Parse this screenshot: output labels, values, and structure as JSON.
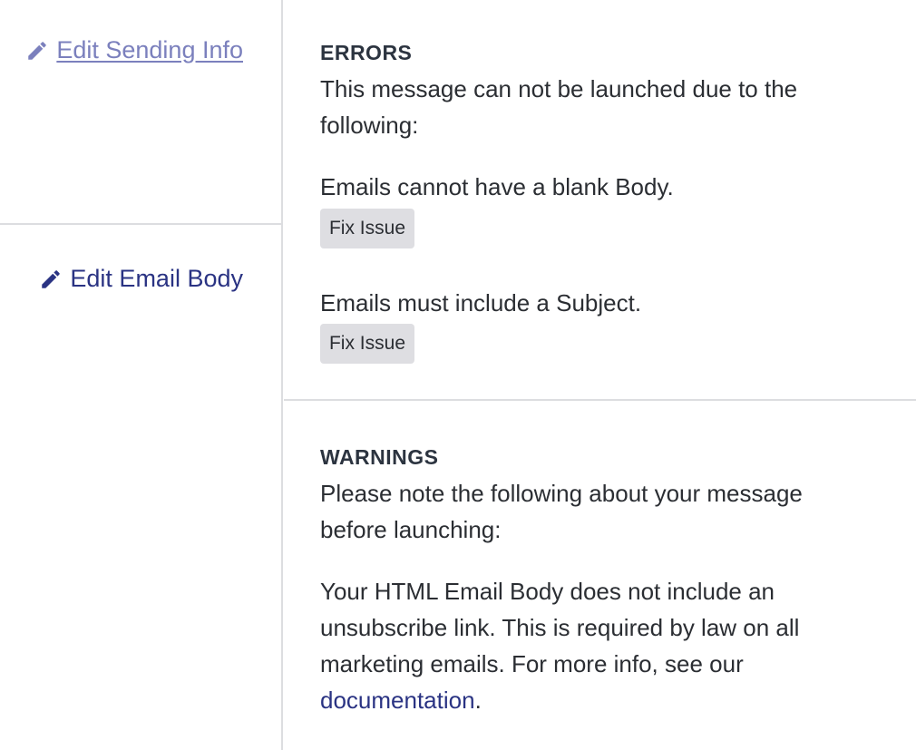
{
  "sidebar": {
    "edit_sending_info": {
      "label": "Edit Sending Info",
      "icon": "pencil-icon"
    },
    "edit_email_body": {
      "label": "Edit Email Body",
      "icon": "pencil-icon"
    }
  },
  "errors": {
    "heading": "ERRORS",
    "intro": "This message can not be launched due to the following:",
    "items": [
      {
        "message": "Emails cannot have a blank Body.",
        "button_label": "Fix Issue"
      },
      {
        "message": "Emails must include a Subject.",
        "button_label": "Fix Issue"
      }
    ]
  },
  "warnings": {
    "heading": "WARNINGS",
    "intro": "Please note the following about your message before launching:",
    "unsubscribe_text": "Your HTML Email Body does not include an unsubscribe link. This is required by law on all marketing emails. For more info, see our ",
    "doc_link_label": "documentation",
    "trailing": "."
  },
  "colors": {
    "link_muted": "#7b80bd",
    "link_primary": "#2a3383",
    "button_bg": "#dedee2",
    "divider": "#dcdde0"
  }
}
